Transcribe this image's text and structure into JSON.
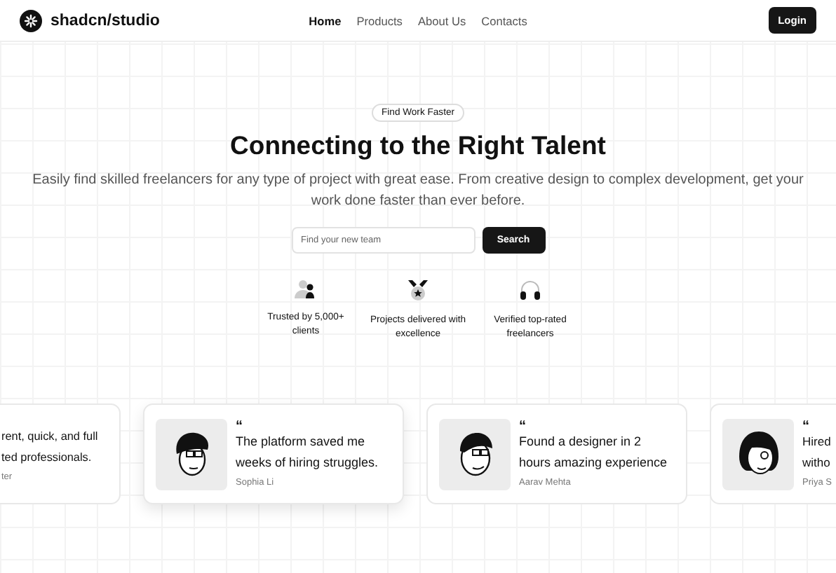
{
  "header": {
    "brand": "shadcn/studio",
    "nav": [
      {
        "label": "Home",
        "selected": true
      },
      {
        "label": "Products",
        "selected": false
      },
      {
        "label": "About Us",
        "selected": false
      },
      {
        "label": "Contacts",
        "selected": false
      }
    ],
    "login": "Login"
  },
  "hero": {
    "badge": "Find Work Faster",
    "title": "Connecting to the Right Talent",
    "subtitle": "Easily find skilled freelancers for any type of project with great ease. From creative design to complex development, get your work done faster than ever before.",
    "search": {
      "placeholder": "Find your new team",
      "button": "Search"
    }
  },
  "features": [
    {
      "kind": "clients",
      "label": "Trusted by 5,000+ clients"
    },
    {
      "kind": "projects",
      "label": "Projects delivered with excellence"
    },
    {
      "kind": "verified",
      "label": "Verified top-rated freelancers"
    }
  ],
  "testimonials": [
    {
      "kind": "text-only",
      "quote": "rent, quick, and full ted professionals.",
      "author": "ter"
    },
    {
      "kind": "glasses",
      "quote_mark": "“",
      "quote": "The platform saved me weeks of hiring struggles.",
      "author": "Sophia Li"
    },
    {
      "kind": "beard",
      "quote_mark": "“",
      "quote": "Found a designer in 2 hours  amazing experience",
      "author": "Aarav Mehta"
    },
    {
      "kind": "woman",
      "quote_mark": "“",
      "quote": "Hired witho",
      "author": "Priya S"
    }
  ]
}
